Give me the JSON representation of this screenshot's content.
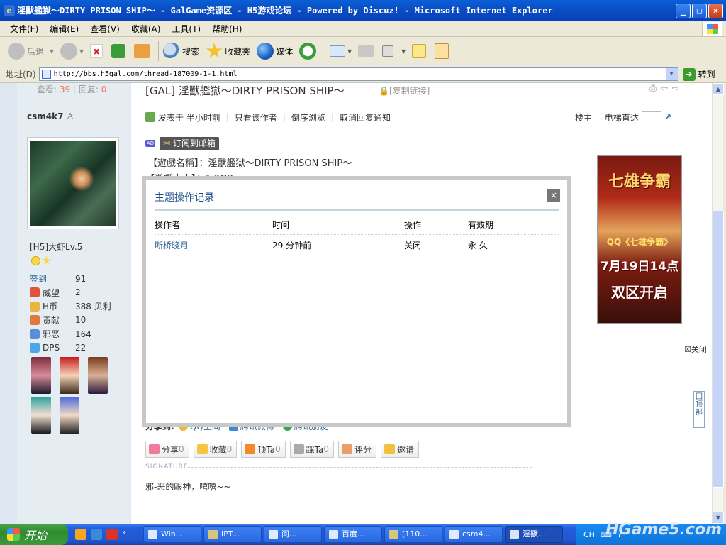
{
  "window": {
    "title": "淫獸艦獄～DIRTY PRISON SHIP～ - GalGame资源区 - H5游戏论坛 - Powered by Discuz! - Microsoft Internet Explorer",
    "min": "_",
    "max": "□",
    "close": "×"
  },
  "menu": [
    "文件(F)",
    "编辑(E)",
    "查看(V)",
    "收藏(A)",
    "工具(T)",
    "帮助(H)"
  ],
  "toolbar": {
    "back": "后退",
    "search": "搜索",
    "favorites": "收藏夹",
    "media": "媒体"
  },
  "address": {
    "label": "地址(D)",
    "url": "http://bbs.h5gal.com/thread-187009-1-1.html",
    "go": "转到"
  },
  "thread": {
    "views_label": "查看:",
    "views": "39",
    "replies_label": "回复:",
    "replies": "0",
    "title": "[GAL] 淫獸艦獄～DIRTY PRISON SHIP～",
    "copy_link": "[复制链接]",
    "posted": "发表于 半小时前",
    "only_author": "只看该作者",
    "reverse": "倒序浏览",
    "cancel_notify": "取消回复通知",
    "floor": "楼主",
    "elevator": "电梯直达",
    "subscribe": "订阅到邮箱",
    "game_name": "【遊戲名稱】：淫獸艦獄～DIRTY PRISON SHIP～",
    "game_size": "【遊戲大小】：1.2GB"
  },
  "user": {
    "name": "csm4k7",
    "level": "[H5]大虾Lv.5",
    "stats": [
      {
        "k": "签到",
        "v": "91",
        "link": true
      },
      {
        "k": "威望",
        "v": "2",
        "color": "#e0543a"
      },
      {
        "k": "H币",
        "v": "388 贝利",
        "color": "#e9b640"
      },
      {
        "k": "贡献",
        "v": "10",
        "color": "#e07a3a"
      },
      {
        "k": "邪恶",
        "v": "164",
        "color": "#5a8fd8"
      },
      {
        "k": "DPS",
        "v": "22",
        "color": "#4aa8e8"
      }
    ]
  },
  "ad": {
    "l1": "七雄争霸",
    "l2": "QQ《七雄争霸》",
    "l3": "7月19日14点",
    "l4": "双区开启",
    "close": "关闭"
  },
  "share": {
    "label": "分享到:",
    "items": [
      "QQ空间",
      "腾讯微博",
      "腾讯朋友"
    ]
  },
  "actions": [
    {
      "label": "分享",
      "count": "0",
      "color": "#f07a9a"
    },
    {
      "label": "收藏",
      "count": "0",
      "color": "#f5c542"
    },
    {
      "label": "顶Ta",
      "count": "0",
      "color": "#f08a2a"
    },
    {
      "label": "踩Ta",
      "count": "0",
      "color": "#aaa"
    },
    {
      "label": "评分",
      "count": "",
      "color": "#e8a06a"
    },
    {
      "label": "邀请",
      "count": "",
      "color": "#f0c040"
    }
  ],
  "signature": {
    "label": "SIGNATURE",
    "text": "邪-恶的眼神，嘻嘻~~"
  },
  "backtop": "回顶部",
  "modal": {
    "title": "主题操作记录",
    "close": "×",
    "headers": [
      "操作者",
      "时间",
      "操作",
      "有效期"
    ],
    "rows": [
      [
        "断桥晓月",
        "29 分钟前",
        "关闭",
        "永 久"
      ]
    ]
  },
  "taskbar": {
    "start": "开始",
    "tasks": [
      "Win...",
      "IPT...",
      "问...",
      "百度...",
      "[110...",
      "csm4...",
      "淫獸..."
    ],
    "lang": "CH",
    "watermark": "HGame5.com"
  }
}
